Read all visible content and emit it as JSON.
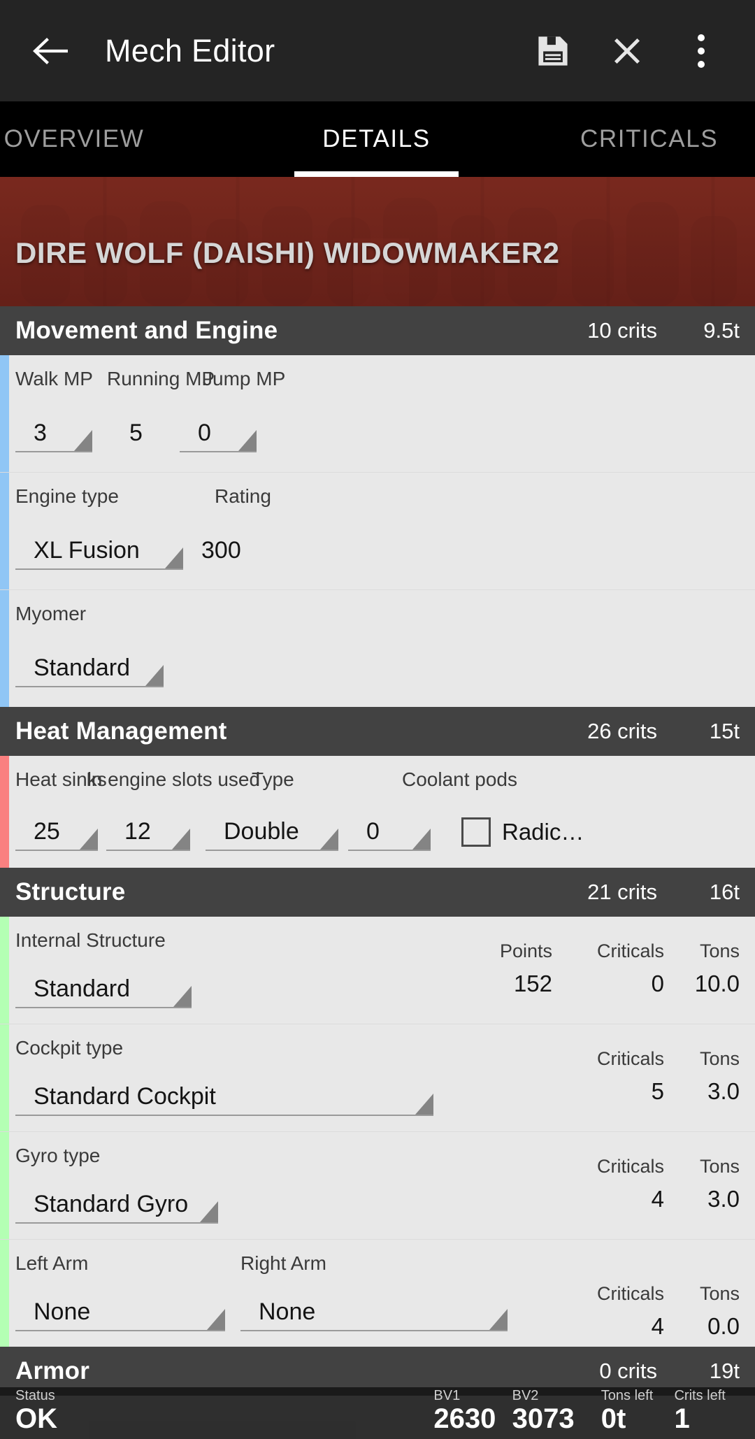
{
  "appbar": {
    "title": "Mech Editor",
    "back_icon": "arrow-left-icon",
    "save_icon": "save-floppy-icon",
    "close_icon": "close-x-icon",
    "overflow_icon": "more-vertical-icon"
  },
  "tabs": [
    {
      "label": "OVERVIEW",
      "active": false
    },
    {
      "label": "DETAILS",
      "active": true
    },
    {
      "label": "CRITICALS",
      "active": false
    }
  ],
  "hero": {
    "title": "DIRE WOLF (DAISHI)  WIDOWMAKER2"
  },
  "sections": {
    "movement": {
      "title": "Movement and Engine",
      "crits": "10 crits",
      "tons": "9.5t",
      "accent_color": "#90c6f5",
      "labels": {
        "walk": "Walk MP",
        "run": "Running MP",
        "jump": "Jump MP",
        "engine_type": "Engine type",
        "rating": "Rating",
        "myomer": "Myomer"
      },
      "values": {
        "walk": "3",
        "run": "5",
        "jump": "0",
        "engine_type": "XL Fusion",
        "rating": "300",
        "myomer": "Standard"
      }
    },
    "heat": {
      "title": "Heat Management",
      "crits": "26 crits",
      "tons": "15t",
      "accent_color": "#fa8080",
      "labels": {
        "sinks": "Heat sinks",
        "in_engine": "In engine slots used",
        "type": "Type",
        "coolant": "Coolant pods"
      },
      "values": {
        "sinks": "25",
        "in_engine": "12",
        "type": "Double",
        "coolant": "0"
      },
      "checkbox": {
        "label": "Radic…",
        "checked": false
      }
    },
    "structure": {
      "title": "Structure",
      "crits": "21 crits",
      "tons": "16t",
      "accent_color": "#b4ffb4",
      "internal": {
        "label": "Internal Structure",
        "value": "Standard",
        "heads": [
          "Points",
          "Criticals",
          "Tons"
        ],
        "vals": [
          "152",
          "0",
          "10.0"
        ]
      },
      "cockpit": {
        "label": "Cockpit type",
        "value": "Standard Cockpit",
        "heads": [
          "Criticals",
          "Tons"
        ],
        "vals": [
          "5",
          "3.0"
        ]
      },
      "gyro": {
        "label": "Gyro type",
        "value": "Standard Gyro",
        "heads": [
          "Criticals",
          "Tons"
        ],
        "vals": [
          "4",
          "3.0"
        ]
      },
      "arms": {
        "left_label": "Left Arm",
        "right_label": "Right Arm",
        "left_value": "None",
        "right_value": "None",
        "heads": [
          "Criticals",
          "Tons"
        ],
        "vals": [
          "4",
          "0.0"
        ]
      }
    },
    "armor": {
      "title": "Armor",
      "crits": "0 crits",
      "tons": "19t"
    }
  },
  "statusbar": {
    "status_label": "Status",
    "status_value": "OK",
    "bv1_label": "BV1",
    "bv1_value": "2630",
    "bv2_label": "BV2",
    "bv2_value": "3073",
    "tons_left_label": "Tons left",
    "tons_left_value": "0t",
    "crits_left_label": "Crits left",
    "crits_left_value": "1"
  }
}
